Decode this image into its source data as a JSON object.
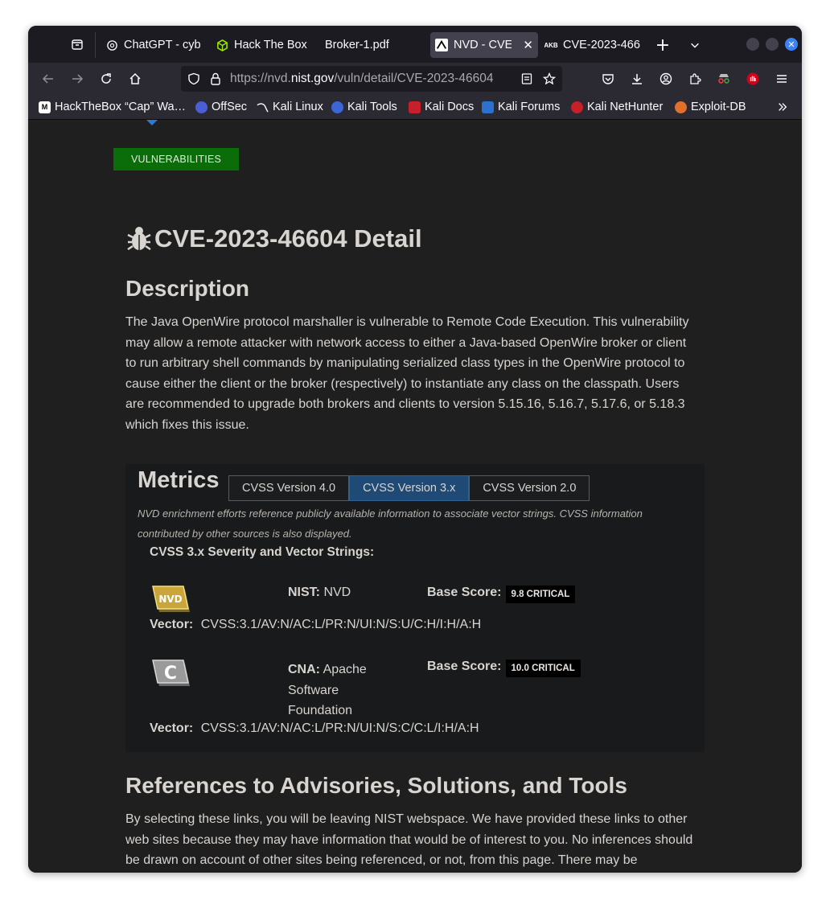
{
  "tabs": [
    {
      "label": "ChatGPT - cyb",
      "icon": "chatgpt-icon"
    },
    {
      "label": "Hack The Box :",
      "icon": "hackthebox-icon"
    },
    {
      "label": "Broker-1.pdf",
      "icon": "pdf-icon"
    },
    {
      "label": "NVD - CVE-",
      "icon": "nvd-icon",
      "active": true
    },
    {
      "label": "CVE-2023-466",
      "icon": "akb-icon"
    }
  ],
  "url": {
    "prefix": "https://nvd.",
    "domain": "nist.gov",
    "path": "/vuln/detail/CVE-2023-46604"
  },
  "bookmarks": [
    {
      "label": "HackTheBox “Cap” Wa…",
      "icon": "medium-icon",
      "color": "#000000"
    },
    {
      "label": "OffSec",
      "icon": "offsec-icon",
      "color": "#4a5fd6"
    },
    {
      "label": "Kali Linux",
      "icon": "kali-icon",
      "color": "#2b2a33"
    },
    {
      "label": "Kali Tools",
      "icon": "kali-tools-icon",
      "color": "#3b66d6"
    },
    {
      "label": "Kali Docs",
      "icon": "kali-docs-icon",
      "color": "#c8202b"
    },
    {
      "label": "Kali Forums",
      "icon": "kali-forums-icon",
      "color": "#2a71d0"
    },
    {
      "label": "Kali NetHunter",
      "icon": "kali-nethunter-icon",
      "color": "#c8202b"
    },
    {
      "label": "Exploit-DB",
      "icon": "exploit-db-icon",
      "color": "#e3702a"
    }
  ],
  "page": {
    "section_button": "VULNERABILITIES",
    "title": "CVE-2023-46604 Detail",
    "description_heading": "Description",
    "description": "The Java OpenWire protocol marshaller is vulnerable to Remote Code Execution. This vulnerability may allow a remote attacker with network access to either a Java-based OpenWire broker or client to run arbitrary shell commands by manipulating serialized class types in the OpenWire protocol to cause either the client or the broker (respectively) to instantiate any class on the classpath. Users are recommended to upgrade both brokers and clients to version 5.15.16, 5.16.7, 5.17.6, or 5.18.3 which fixes this issue.",
    "metrics": {
      "heading": "Metrics",
      "tabs": [
        "CVSS Version 4.0",
        "CVSS Version 3.x",
        "CVSS Version 2.0"
      ],
      "active_tab": "CVSS Version 3.x",
      "note": "NVD enrichment efforts reference publicly available information to associate vector strings. CVSS information contributed by other sources is also displayed.",
      "subheading": "CVSS 3.x Severity and Vector Strings:",
      "entries": [
        {
          "logo": "NVD",
          "source_label": "NIST:",
          "source": "NVD",
          "score_label": "Base Score:",
          "score": "9.8 CRITICAL",
          "vector_label": "Vector:",
          "vector": "CVSS:3.1/AV:N/AC:L/PR:N/UI:N/S:U/C:H/I:H/A:H"
        },
        {
          "logo": "C",
          "source_label": "CNA:",
          "source": "Apache Software Foundation",
          "score_label": "Base Score:",
          "score": "10.0 CRITICAL",
          "vector_label": "Vector:",
          "vector": "CVSS:3.1/AV:N/AC:L/PR:N/UI:N/S:C/C:L/I:H/A:H"
        }
      ]
    },
    "references_heading": "References to Advisories, Solutions, and Tools",
    "references_text": "By selecting these links, you will be leaving NIST webspace. We have provided these links to other web sites because they may have information that would be of interest to you. No inferences should be drawn on account of other sites being referenced, or not, from this page. There may be"
  },
  "colors": {
    "accent_green": "#0a6d0a",
    "active_tab_blue": "#1f4a75",
    "badge_black": "#000000"
  }
}
